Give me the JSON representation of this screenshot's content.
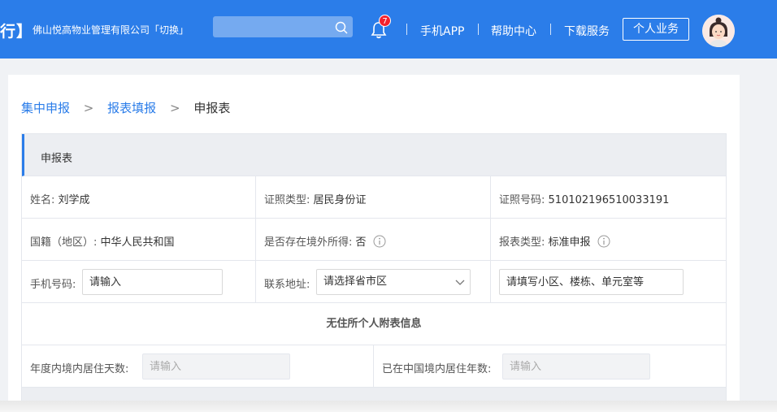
{
  "header": {
    "brand_tail": "行】",
    "company": "佛山悦高物业管理有限公司「切换」",
    "search_placeholder": "",
    "notification_count": "7",
    "nav": [
      "手机APP",
      "帮助中心",
      "下载服务"
    ],
    "personal_button": "个人业务",
    "accent": "#2b7de9"
  },
  "breadcrumb": {
    "items": [
      "集中申报",
      "报表填报",
      "申报表"
    ],
    "separator": ">"
  },
  "form": {
    "title": "申报表",
    "name_label": "姓名:",
    "name_value": "刘学成",
    "id_type_label": "证照类型:",
    "id_type_value": "居民身份证",
    "id_number_label": "证照号码:",
    "id_number_value": "510102196510033191",
    "nationality_label": "国籍（地区）:",
    "nationality_value": "中华人民共和国",
    "overseas_label": "是否存在境外所得:",
    "overseas_value": "否",
    "report_type_label": "报表类型:",
    "report_type_value": "标准申报",
    "phone_label": "手机号码:",
    "phone_placeholder": "请输入",
    "address_label": "联系地址:",
    "address_select": "请选择省市区",
    "address_detail_placeholder": "请填写小区、楼栋、单元室等",
    "section_title": "无住所个人附表信息",
    "days_label": "年度内境内居住天数:",
    "days_placeholder": "请输入",
    "years_label": "已在中国境内居住年数:",
    "years_placeholder": "请输入"
  }
}
